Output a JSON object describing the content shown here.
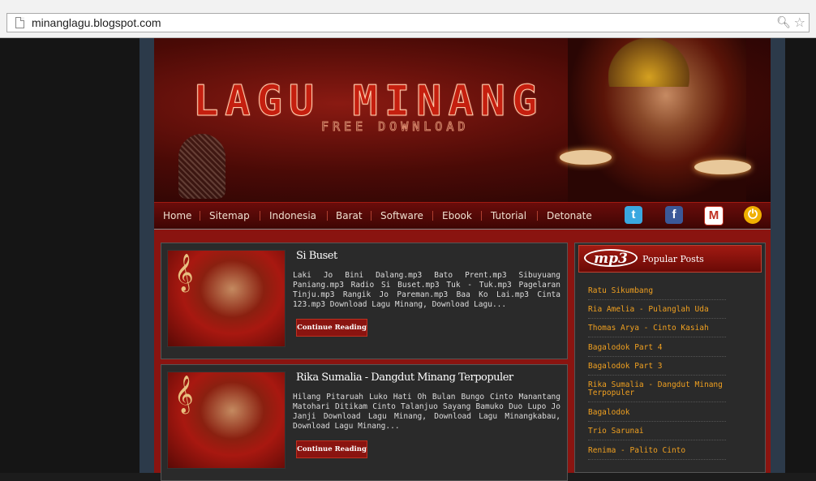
{
  "browser": {
    "url": "minanglagu.blogspot.com"
  },
  "header": {
    "title": "LAGU MINANG",
    "subtitle": "FREE DOWNLOAD"
  },
  "nav": {
    "items": [
      "Home",
      "Sitemap",
      "Indonesia",
      "Barat",
      "Software",
      "Ebook",
      "Tutorial",
      "Detonate"
    ]
  },
  "social": {
    "twitter": "t",
    "facebook": "f",
    "gmail": "M",
    "rss": "⏻"
  },
  "posts": [
    {
      "title": "Si Buset",
      "excerpt": "Laki Jo Bini Dalang.mp3 Bato Prent.mp3 Sibuyuang Paniang.mp3 Radio Si Buset.mp3 Tuk - Tuk.mp3 Pagelaran Tinju.mp3 Rangik Jo Pareman.mp3 Baa Ko Lai.mp3 Cinta 123.mp3 Download Lagu Minang, Download Lagu...",
      "button": "Continue Reading"
    },
    {
      "title": "Rika Sumalia - Dangdut Minang Terpopuler",
      "excerpt": "Hilang Pitaruah Luko Hati Oh Bulan Bungo Cinto Manantang Matohari Ditikam Cinto Talanjuo Sayang Bamuko Duo Lupo Jo Janji Download Lagu Minang, Download Lagu Minangkabau, Download Lagu Minang...",
      "button": "Continue Reading"
    }
  ],
  "sidebar": {
    "logo": "mp3",
    "title": "Popular Posts",
    "items": [
      "Ratu Sikumbang",
      "Ria Amelia - Pulanglah Uda",
      "Thomas Arya - Cinto Kasiah",
      "Bagalodok Part 4",
      "Bagalodok Part 3",
      "Rika Sumalia - Dangdut Minang Terpopuler",
      "Bagalodok",
      "Trio Sarunai",
      "Renima - Palito Cinto"
    ]
  }
}
